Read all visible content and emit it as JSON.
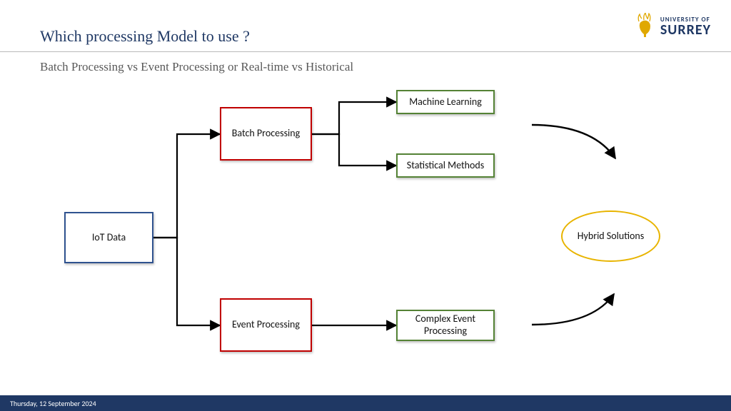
{
  "header": {
    "title": "Which processing Model to use ?",
    "subtitle": "Batch Processing vs Event Processing or Real-time vs Historical"
  },
  "logo": {
    "line1": "UNIVERSITY OF",
    "line2": "SURREY"
  },
  "nodes": {
    "iot": "IoT Data",
    "batch": "Batch Processing",
    "event": "Event Processing",
    "ml": "Machine Learning",
    "stats": "Statistical Methods",
    "cep": "Complex Event Processing",
    "hybrid": "Hybrid Solutions"
  },
  "footer": {
    "date": "Thursday, 12 September 2024"
  }
}
